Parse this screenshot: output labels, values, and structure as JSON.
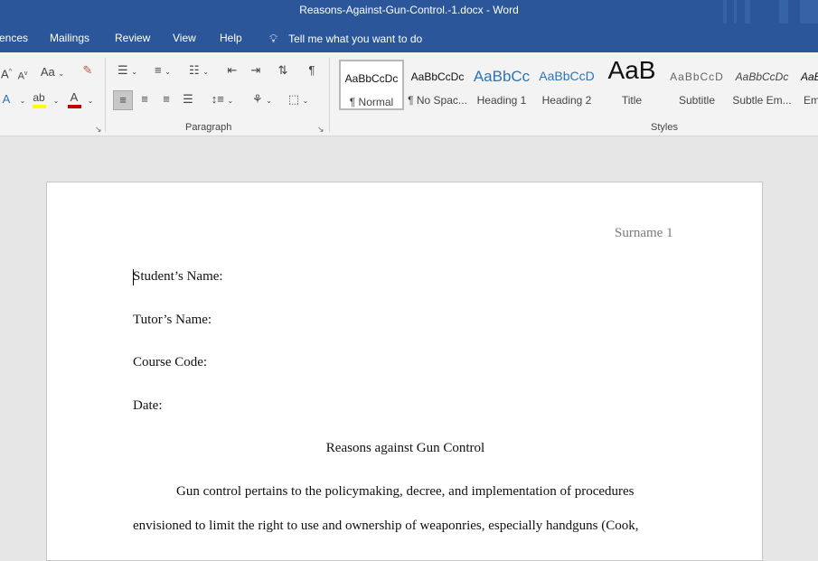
{
  "window": {
    "title": "Reasons-Against-Gun-Control.-1.docx  -  Word"
  },
  "menu": {
    "tabs": [
      "ences",
      "Mailings",
      "Review",
      "View",
      "Help"
    ],
    "tell_me": "Tell me what you want to do"
  },
  "ribbon": {
    "font_group": {
      "grow_font": "A",
      "shrink_font": "A",
      "change_case": "Aa",
      "text_effects": "A",
      "font_color": "A"
    },
    "paragraph_label": "Paragraph",
    "styles_label": "Styles",
    "styles": [
      {
        "preview": "AaBbCcDc",
        "name": "¶ Normal"
      },
      {
        "preview": "AaBbCcDc",
        "name": "¶ No Spac..."
      },
      {
        "preview": "AaBbCc",
        "name": "Heading 1"
      },
      {
        "preview": "AaBbCcD",
        "name": "Heading 2"
      },
      {
        "preview": "AaB",
        "name": "Title"
      },
      {
        "preview": "AaBbCcD",
        "name": "Subtitle"
      },
      {
        "preview": "AaBbCcDc",
        "name": "Subtle Em..."
      },
      {
        "preview": "AaBl",
        "name": "Em"
      }
    ],
    "colors": {
      "highlight": "#ffff00",
      "font_color": "#c00000",
      "heading_blue": "#2e74b5"
    }
  },
  "document": {
    "header": "Surname 1",
    "lines": {
      "student": "Student’s Name:",
      "tutor": "Tutor’s Name:",
      "course": "Course Code:",
      "date": "Date:",
      "title": "Reasons against Gun Control",
      "body1": "Gun control pertains to the policymaking, decree, and implementation of procedures",
      "body2": "envisioned to limit the right to use and ownership of weaponries, especially handguns (Cook,"
    }
  },
  "theme": {
    "brand": "#2b579a",
    "ribbon_bg": "#f3f3f3",
    "canvas_bg": "#e6e6e6"
  }
}
